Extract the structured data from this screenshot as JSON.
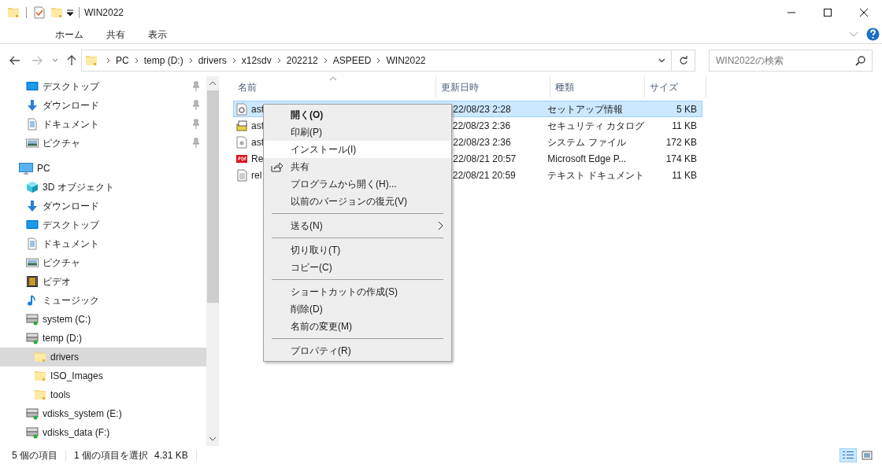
{
  "window": {
    "title": "WIN2022"
  },
  "ribbon_tabs": [
    {
      "label": "ホーム",
      "selected": false
    },
    {
      "label": "共有",
      "selected": false
    },
    {
      "label": "表示",
      "selected": false
    }
  ],
  "address": {
    "crumbs": [
      "PC",
      "temp (D:)",
      "drivers",
      "x12sdv",
      "202212",
      "ASPEED",
      "WIN2022"
    ]
  },
  "search": {
    "placeholder": "WIN2022の検索"
  },
  "sidebar": {
    "quick_access": [
      {
        "label": "デスクトップ",
        "kind": "desktop",
        "pinned": true
      },
      {
        "label": "ダウンロード",
        "kind": "download",
        "pinned": true
      },
      {
        "label": "ドキュメント",
        "kind": "document",
        "pinned": true
      },
      {
        "label": "ピクチャ",
        "kind": "picture",
        "pinned": true
      }
    ],
    "tree": [
      {
        "label": "PC",
        "kind": "pc",
        "selected": false,
        "children": [
          {
            "label": "3D オブジェクト",
            "kind": "cube",
            "selected": false
          },
          {
            "label": "ダウンロード",
            "kind": "download",
            "selected": false
          },
          {
            "label": "デスクトップ",
            "kind": "desktop",
            "selected": false
          },
          {
            "label": "ドキュメント",
            "kind": "document",
            "selected": false
          },
          {
            "label": "ピクチャ",
            "kind": "picture",
            "selected": false
          },
          {
            "label": "ビデオ",
            "kind": "video",
            "selected": false
          },
          {
            "label": "ミュージック",
            "kind": "music",
            "selected": false
          },
          {
            "label": "system (C:)",
            "kind": "drive",
            "selected": false
          },
          {
            "label": "temp (D:)",
            "kind": "drive",
            "selected": false,
            "children": [
              {
                "label": "drivers",
                "kind": "folder",
                "selected": true
              },
              {
                "label": "ISO_Images",
                "kind": "folder",
                "selected": false
              },
              {
                "label": "tools",
                "kind": "folder",
                "selected": false
              }
            ]
          },
          {
            "label": "vdisks_system (E:)",
            "kind": "drive",
            "selected": false
          },
          {
            "label": "vdisks_data (F:)",
            "kind": "drive",
            "selected": false
          }
        ]
      }
    ]
  },
  "table": {
    "columns": [
      "名前",
      "更新日時",
      "種類",
      "サイズ"
    ],
    "rows": [
      {
        "name": "ast",
        "kind": "setup",
        "date": "22/08/23 2:28",
        "type": "セットアップ情報",
        "size": "5 KB",
        "selected": true
      },
      {
        "name": "ast",
        "kind": "catalog",
        "date": "22/08/23 2:36",
        "type": "セキュリティ カタログ",
        "size": "11 KB",
        "selected": false
      },
      {
        "name": "ast",
        "kind": "system",
        "date": "22/08/23 2:36",
        "type": "システム ファイル",
        "size": "172 KB",
        "selected": false
      },
      {
        "name": "Re",
        "kind": "pdf",
        "date": "22/08/21 20:57",
        "type": "Microsoft Edge P...",
        "size": "174 KB",
        "selected": false
      },
      {
        "name": "rel",
        "kind": "text",
        "date": "22/08/21 20:59",
        "type": "テキスト ドキュメント",
        "size": "11 KB",
        "selected": false
      }
    ]
  },
  "context_menu": [
    {
      "kind": "item",
      "label": "開く(O)",
      "default": true,
      "selected": false
    },
    {
      "kind": "item",
      "label": "印刷(P)",
      "default": false,
      "selected": false
    },
    {
      "kind": "item",
      "label": "インストール(I)",
      "default": false,
      "selected": true
    },
    {
      "kind": "share",
      "label": "共有",
      "default": false,
      "selected": false
    },
    {
      "kind": "item",
      "label": "プログラムから開く(H)...",
      "default": false,
      "selected": false
    },
    {
      "kind": "item",
      "label": "以前のバージョンの復元(V)",
      "default": false,
      "selected": false
    },
    {
      "kind": "separator"
    },
    {
      "kind": "submenu",
      "label": "送る(N)",
      "default": false,
      "selected": false
    },
    {
      "kind": "separator"
    },
    {
      "kind": "item",
      "label": "切り取り(T)",
      "default": false,
      "selected": false
    },
    {
      "kind": "item",
      "label": "コピー(C)",
      "default": false,
      "selected": false
    },
    {
      "kind": "separator"
    },
    {
      "kind": "item",
      "label": "ショートカットの作成(S)",
      "default": false,
      "selected": false
    },
    {
      "kind": "item",
      "label": "削除(D)",
      "default": false,
      "selected": false
    },
    {
      "kind": "item",
      "label": "名前の変更(M)",
      "default": false,
      "selected": false
    },
    {
      "kind": "separator"
    },
    {
      "kind": "item",
      "label": "プロパティ(R)",
      "default": false,
      "selected": false
    }
  ],
  "status_bar": {
    "count": "5 個の項目",
    "selection": "1 個の項目を選択",
    "size": "4.31 KB",
    "view_buttons": [
      {
        "kind": "details",
        "selected": true
      },
      {
        "kind": "large_icons",
        "selected": false
      }
    ]
  }
}
